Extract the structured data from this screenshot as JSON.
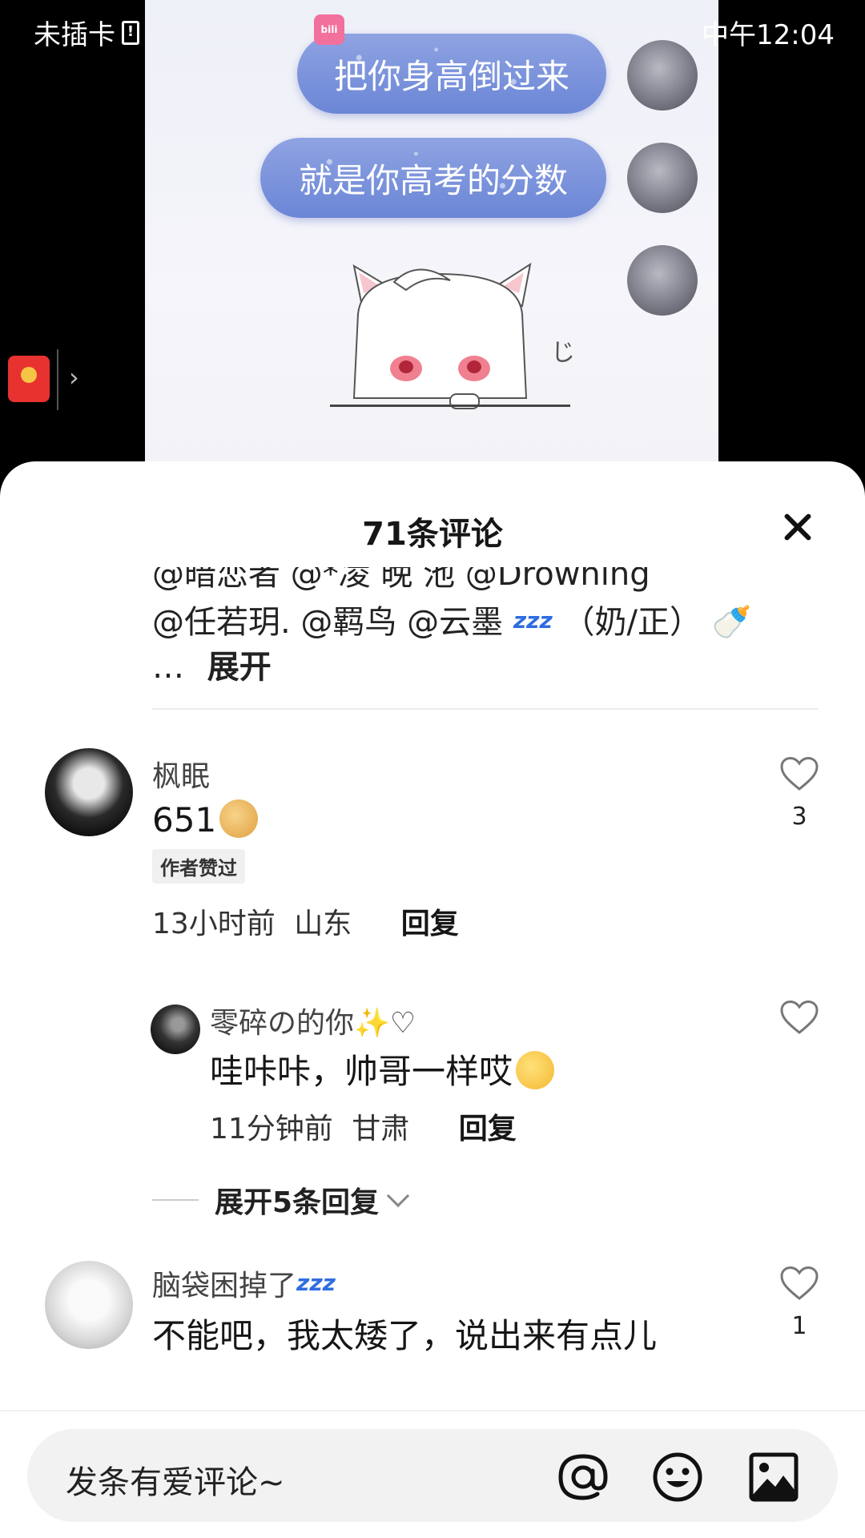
{
  "status_bar": {
    "carrier": "未插卡",
    "time": "中午12:04",
    "app_badge": "bilibili"
  },
  "video": {
    "bubbles": [
      "把你身高倒过来",
      "就是你高考的分数"
    ]
  },
  "sheet": {
    "title": "71条评论"
  },
  "previous_comment": {
    "line1": "@暗恋者 @*凌 晚 池 @Drowning",
    "line2_a": "@任若玥. @羁鸟 @云墨",
    "line2_b": "（奶/正）",
    "ellipsis": "…",
    "expand": "展开"
  },
  "comments": [
    {
      "user": "枫眠",
      "text": "651",
      "badge": "作者赞过",
      "time": "13小时前",
      "location": "山东",
      "reply": "回复",
      "likes": "3",
      "replies": [
        {
          "user": "零碎の的你",
          "text": "哇咔咔，帅哥一样哎",
          "time": "11分钟前",
          "location": "甘肃",
          "reply": "回复"
        }
      ],
      "expand_replies": "展开5条回复"
    },
    {
      "user": "脑袋困掉了",
      "text": "不能吧，我太矮了，说出来有点儿",
      "likes": "1"
    }
  ],
  "input": {
    "placeholder": "发条有爱评论~"
  },
  "colors": {
    "bubble": "#7b93dc",
    "sheet_bg": "#ffffff",
    "input_bg": "#f2f2f2"
  }
}
